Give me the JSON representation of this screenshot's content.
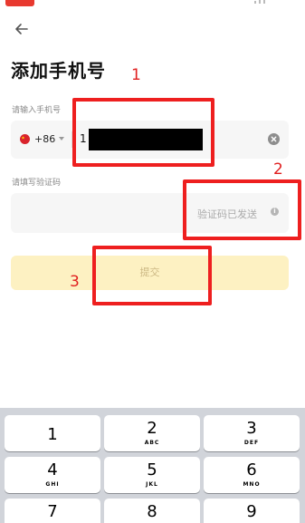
{
  "page_title": "添加手机号",
  "back_icon": "arrow-left-icon",
  "phone_field": {
    "label": "请输入手机号",
    "country_code": "+86",
    "flag_icon": "china-flag-icon",
    "value": "1",
    "clear_icon": "clear-circle-icon"
  },
  "code_field": {
    "label": "请填写验证码",
    "status": "验证码已发送",
    "info_icon": "info-icon"
  },
  "submit": {
    "label": "提交"
  },
  "annotations": [
    {
      "number": "1",
      "color": "#ee1f1f"
    },
    {
      "number": "2",
      "color": "#ee1f1f"
    },
    {
      "number": "3",
      "color": "#ee1f1f"
    }
  ],
  "keyboard": {
    "keys": [
      {
        "num": "1",
        "letters": ""
      },
      {
        "num": "2",
        "letters": "ABC"
      },
      {
        "num": "3",
        "letters": "DEF"
      },
      {
        "num": "4",
        "letters": "GHI"
      },
      {
        "num": "5",
        "letters": "JKL"
      },
      {
        "num": "6",
        "letters": "MNO"
      },
      {
        "num": "7",
        "letters": ""
      },
      {
        "num": "8",
        "letters": ""
      },
      {
        "num": "9",
        "letters": ""
      }
    ]
  },
  "colors": {
    "accent_red": "#e8392f",
    "submit_bg": "#fdf1c2",
    "keyboard_bg": "#d1d4da"
  }
}
